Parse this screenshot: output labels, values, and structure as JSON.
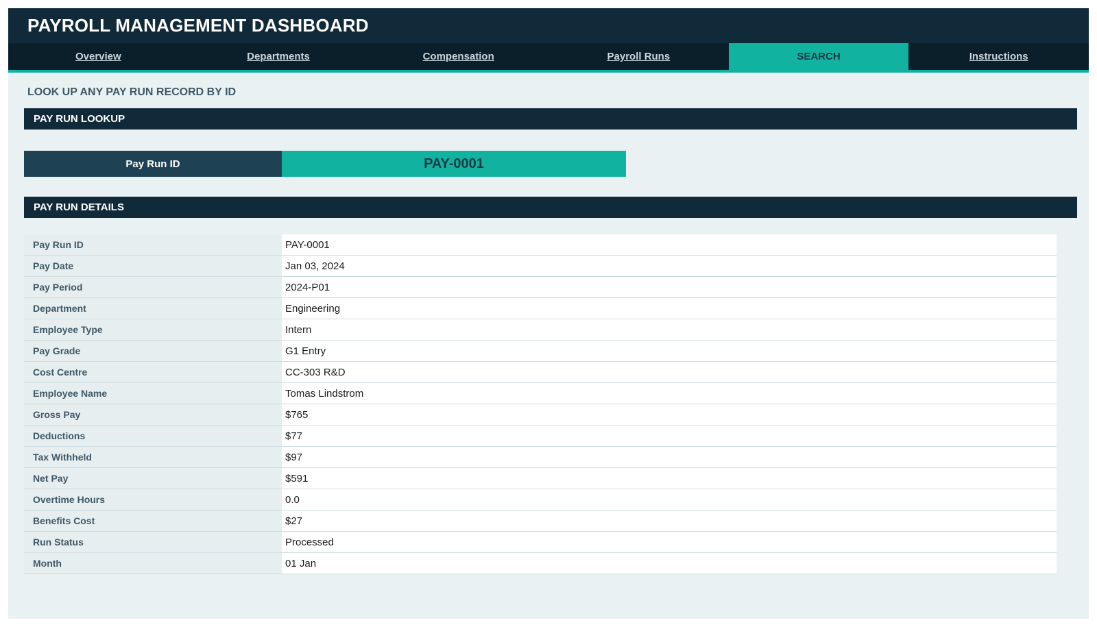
{
  "header": {
    "title": "PAYROLL MANAGEMENT DASHBOARD"
  },
  "nav": {
    "tabs": [
      {
        "label": "Overview",
        "active": false
      },
      {
        "label": "Departments",
        "active": false
      },
      {
        "label": "Compensation",
        "active": false
      },
      {
        "label": "Payroll Runs",
        "active": false
      },
      {
        "label": "SEARCH",
        "active": true
      },
      {
        "label": "Instructions",
        "active": false
      }
    ]
  },
  "page": {
    "subtitle": "LOOK UP ANY PAY RUN RECORD BY ID"
  },
  "lookup": {
    "section_title": "PAY RUN LOOKUP",
    "label": "Pay Run ID",
    "value": "PAY-0001"
  },
  "details": {
    "section_title": "PAY RUN DETAILS",
    "rows": [
      {
        "label": "Pay Run ID",
        "value": "PAY-0001"
      },
      {
        "label": "Pay Date",
        "value": "Jan 03, 2024"
      },
      {
        "label": "Pay Period",
        "value": "2024-P01"
      },
      {
        "label": "Department",
        "value": "Engineering"
      },
      {
        "label": "Employee Type",
        "value": "Intern"
      },
      {
        "label": "Pay Grade",
        "value": "G1 Entry"
      },
      {
        "label": "Cost Centre",
        "value": "CC-303 R&D"
      },
      {
        "label": "Employee Name",
        "value": "Tomas Lindstrom"
      },
      {
        "label": "Gross Pay",
        "value": "$765"
      },
      {
        "label": "Deductions",
        "value": "$77"
      },
      {
        "label": "Tax Withheld",
        "value": "$97"
      },
      {
        "label": "Net Pay",
        "value": "$591"
      },
      {
        "label": "Overtime Hours",
        "value": "0.0"
      },
      {
        "label": "Benefits Cost",
        "value": "$27"
      },
      {
        "label": "Run Status",
        "value": "Processed"
      },
      {
        "label": "Month",
        "value": "01 Jan"
      }
    ]
  },
  "colors": {
    "header_bg": "#112a3a",
    "nav_bg": "#0b1f2b",
    "accent": "#12b2a0",
    "label_dark": "#1e4154",
    "page_bg": "#eaf1f2"
  }
}
